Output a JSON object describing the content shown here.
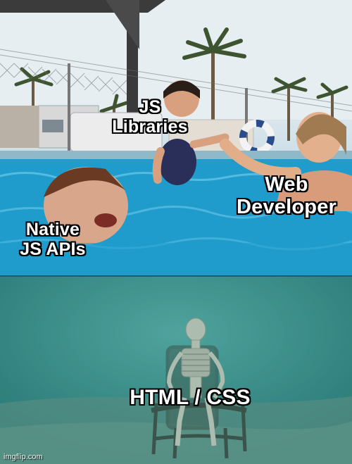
{
  "captions": {
    "js_libraries": "JS\nLibraries",
    "web_developer": "Web\nDeveloper",
    "native_js_apis": "Native\nJS APIs",
    "html_css": "HTML / CSS"
  },
  "watermark": "imgflip.com",
  "colors": {
    "pool_water": "#1f9ccc",
    "underwater": "#2f8583",
    "caption_text": "#ffffff",
    "caption_outline": "#000000"
  }
}
